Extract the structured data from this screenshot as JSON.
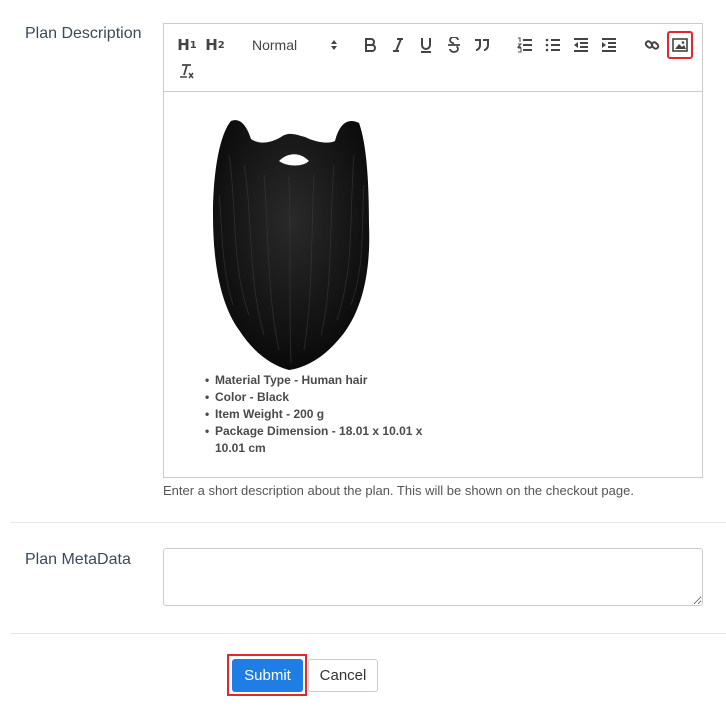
{
  "plan_description": {
    "label": "Plan Description",
    "toolbar": {
      "h1_label": "H",
      "h1_sub": "1",
      "h2_label": "H",
      "h2_sub": "2",
      "format_select": "Normal",
      "icons": [
        "bold-icon",
        "italic-icon",
        "underline-icon",
        "strikethrough-icon",
        "blockquote-icon",
        "ordered-list-icon",
        "bullet-list-icon",
        "outdent-icon",
        "indent-icon",
        "link-icon",
        "image-icon",
        "clear-format-icon"
      ]
    },
    "content": {
      "bullets": [
        "Material Type - Human hair",
        "Color - Black",
        "Item Weight  - 200 g",
        "Package Dimension - 18.01 x 10.01 x 10.01 cm"
      ]
    },
    "help_text": "Enter a short description about the plan. This will be shown on the checkout page."
  },
  "plan_metadata": {
    "label": "Plan MetaData",
    "value": ""
  },
  "actions": {
    "submit_label": "Submit",
    "cancel_label": "Cancel"
  },
  "colors": {
    "primary": "#1e7ee6",
    "highlight": "#e0282e",
    "border": "#cccccc"
  }
}
